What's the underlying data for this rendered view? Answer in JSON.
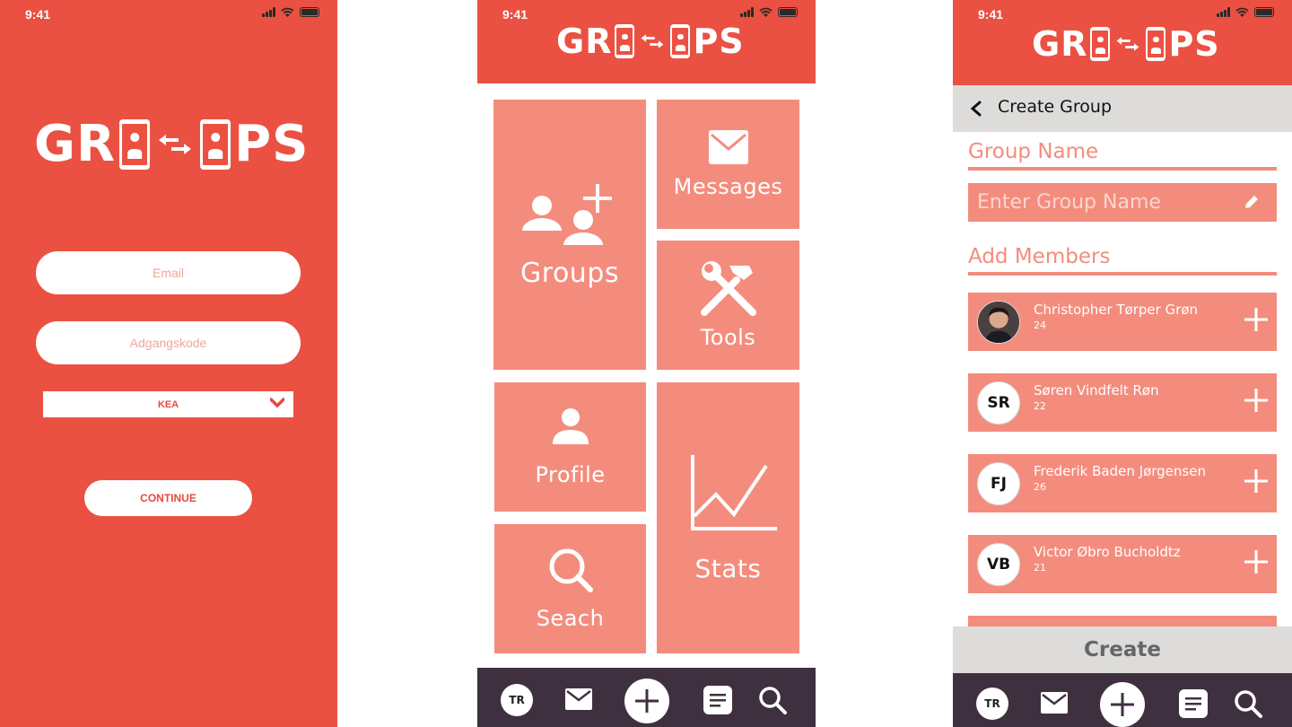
{
  "status": {
    "time": "9:41"
  },
  "brand": {
    "left": "GR",
    "right": "PS",
    "color": "#ea5142",
    "tile_color": "#f48c7d",
    "nav_color": "#3f3040"
  },
  "login": {
    "email_placeholder": "Email",
    "password_placeholder": "Adgangskode",
    "school_selected": "KEA",
    "continue_label": "CONTINUE"
  },
  "dashboard": {
    "tiles": [
      {
        "label": "Groups",
        "icon": "add-group-icon"
      },
      {
        "label": "Messages",
        "icon": "envelope-icon"
      },
      {
        "label": "Tools",
        "icon": "tools-icon"
      },
      {
        "label": "Profile",
        "icon": "user-icon"
      },
      {
        "label": "Stats",
        "icon": "chart-icon"
      },
      {
        "label": "Seach",
        "icon": "search-icon"
      }
    ]
  },
  "navbar": {
    "avatar_initials": "TR"
  },
  "create_group": {
    "title": "Create Group",
    "group_name_label": "Group Name",
    "group_name_placeholder": "Enter Group Name",
    "add_members_label": "Add Members",
    "members": [
      {
        "name": "Christopher Tørper Grøn",
        "age": "24",
        "initials": ""
      },
      {
        "name": "Søren Vindfelt Røn",
        "age": "22",
        "initials": "SR"
      },
      {
        "name": "Frederik Baden Jørgensen",
        "age": "26",
        "initials": "FJ"
      },
      {
        "name": "Victor Øbro Bucholdtz",
        "age": "21",
        "initials": "VB"
      }
    ],
    "create_label": "Create"
  }
}
